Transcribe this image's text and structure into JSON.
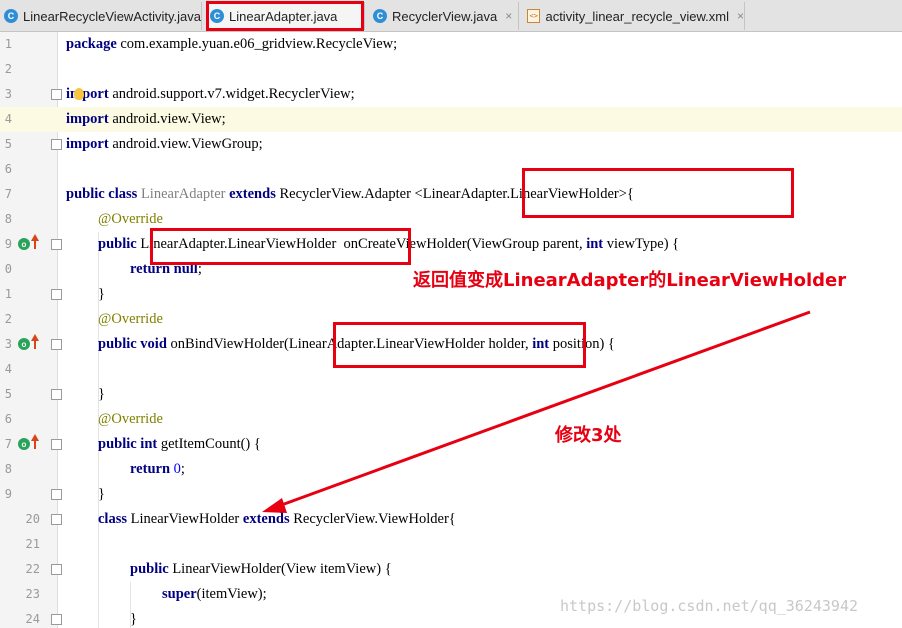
{
  "tabs": [
    {
      "label": "LinearRecycleViewActivity.java",
      "icon": "class-file-icon"
    },
    {
      "label": "LinearAdapter.java",
      "icon": "class-file-icon",
      "active": true
    },
    {
      "label": "RecyclerView.java",
      "icon": "class-file-icon"
    },
    {
      "label": "activity_linear_recycle_view.xml",
      "icon": "xml-file-icon"
    }
  ],
  "tab_close_glyph": "×",
  "tab_file_icon_glyph": "C",
  "gutter": {
    "line_numbers": [
      "1",
      "2",
      "3",
      "4",
      "5",
      "6",
      "7",
      "8",
      "9",
      "0",
      "1",
      "2",
      "3",
      "4",
      "5",
      "6",
      "7",
      "8",
      "9",
      "20",
      "21",
      "22",
      "23",
      "24"
    ]
  },
  "code": {
    "l1_kw": "package",
    "l1_rest": " com.example.yuan.e06_gridview.RecycleView;",
    "l3_kw": "import",
    "l3_rest": " android.support.v7.widget.RecyclerView;",
    "l4_kw": "import",
    "l4_rest": " android.view.View;",
    "l5_kw": "import",
    "l5_rest": " android.view.ViewGroup;",
    "l7_kw1": "public class",
    "l7_name": " LinearAdapter ",
    "l7_kw2": "extends",
    "l7_rest": " RecyclerView.Adapter <LinearAdapter.LinearViewHolder>{",
    "l8_ann": "@Override",
    "l9_kw": "public",
    "l9_rest": " LinearAdapter.LinearViewHolder  onCreateViewHolder(ViewGroup parent, ",
    "l9_kw2": "int",
    "l9_rest2": " viewType) {",
    "l10_kw": "return null",
    "l10_rest": ";",
    "l11": "}",
    "l12_ann": "@Override",
    "l13_kw": "public void",
    "l13_rest": " onBindViewHolder(LinearAdapter.LinearViewHolder holder, ",
    "l13_kw2": "int",
    "l13_rest2": " position) {",
    "l15": "}",
    "l16_ann": "@Override",
    "l17_kw": "public int",
    "l17_rest": " getItemCount() {",
    "l18_kw": "return",
    "l18_num": " 0",
    "l18_rest": ";",
    "l19": "}",
    "l20_kw": "class",
    "l20_name": " LinearViewHolder ",
    "l20_kw2": "extends",
    "l20_rest": " RecyclerView.ViewHolder{",
    "l22_kw": "public",
    "l22_rest": " LinearViewHolder(View itemView) {",
    "l23_kw": "super",
    "l23_rest": "(itemView);",
    "l24": "}"
  },
  "annotations": {
    "return_note": "返回值变成LinearAdapter的LinearViewHolder",
    "modify_note": "修改3处"
  },
  "watermark": "https://blog.csdn.net/qq_36243942",
  "colors": {
    "highlight_box": "#e60012",
    "keyword": "#000080",
    "annotation_code": "#808000",
    "number": "#0000ff",
    "current_line": "#fcfae3"
  }
}
